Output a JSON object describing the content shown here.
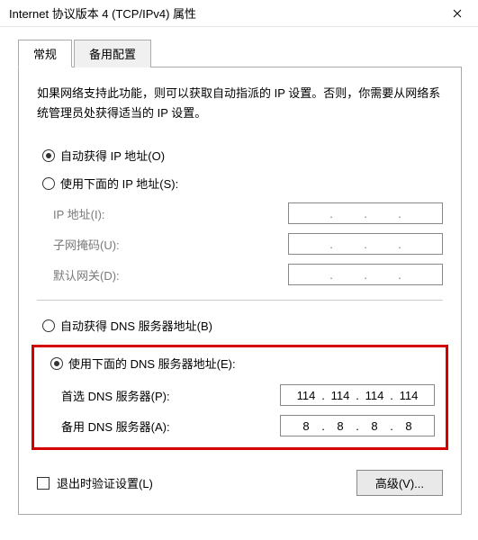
{
  "title": "Internet 协议版本 4 (TCP/IPv4) 属性",
  "tabs": {
    "general": "常规",
    "alternate": "备用配置"
  },
  "description": "如果网络支持此功能，则可以获取自动指派的 IP 设置。否则，你需要从网络系统管理员处获得适当的 IP 设置。",
  "ip": {
    "auto_label": "自动获得 IP 地址(O)",
    "manual_label": "使用下面的 IP 地址(S):",
    "fields": {
      "address_label": "IP 地址(I):",
      "mask_label": "子网掩码(U):",
      "gateway_label": "默认网关(D):"
    }
  },
  "dns": {
    "auto_label": "自动获得 DNS 服务器地址(B)",
    "manual_label": "使用下面的 DNS 服务器地址(E):",
    "primary_label": "首选 DNS 服务器(P):",
    "alternate_label": "备用 DNS 服务器(A):",
    "primary_value": {
      "o1": "114",
      "o2": "114",
      "o3": "114",
      "o4": "114"
    },
    "alternate_value": {
      "o1": "8",
      "o2": "8",
      "o3": "8",
      "o4": "8"
    }
  },
  "validate_label": "退出时验证设置(L)",
  "advanced_label": "高级(V)...",
  "dot": "."
}
